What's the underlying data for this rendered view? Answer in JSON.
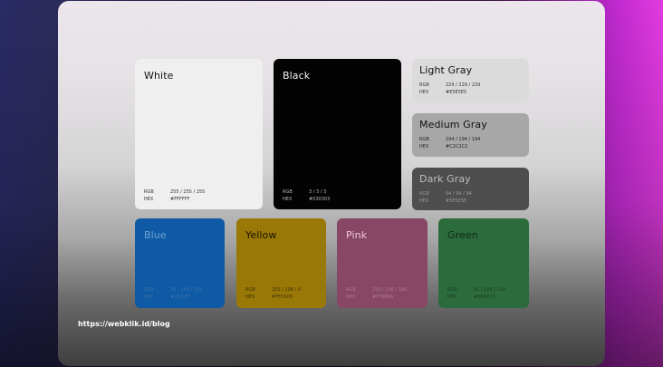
{
  "swatches": {
    "white": {
      "name": "White",
      "rgb_label": "RGB",
      "rgb": "255 / 255 / 255",
      "hex_label": "HEX",
      "hex": "#FFFFFF",
      "color": "#f0f0f0"
    },
    "black": {
      "name": "Black",
      "rgb_label": "RGB",
      "rgb": "3 / 3 / 3",
      "hex_label": "HEX",
      "hex": "#030303",
      "color": "#030303"
    },
    "light_gray": {
      "name": "Light Gray",
      "rgb_label": "RGB",
      "rgb": "229 / 229 / 229",
      "hex_label": "HEX",
      "hex": "#E5E5E5",
      "color": "#dcdcdc"
    },
    "medium_gray": {
      "name": "Medium Gray",
      "rgb_label": "RGB",
      "rgb": "194 / 194 / 194",
      "hex_label": "HEX",
      "hex": "#C2C2C2",
      "color": "#a9a9a9"
    },
    "dark_gray": {
      "name": "Dark Gray",
      "rgb_label": "RGB",
      "rgb": "94 / 94 / 94",
      "hex_label": "HEX",
      "hex": "#5E5E5E",
      "color": "#555555"
    },
    "blue": {
      "name": "Blue",
      "rgb_label": "RGB",
      "rgb": "30 / 144 / 255",
      "hex_label": "HEX",
      "hex": "#1E90FF",
      "color": "#0f5aa8"
    },
    "yellow": {
      "name": "Yellow",
      "rgb_label": "RGB",
      "rgb": "255 / 198 / 0",
      "hex_label": "HEX",
      "hex": "#FFC600",
      "color": "#9c7a05"
    },
    "pink": {
      "name": "Pink",
      "rgb_label": "RGB",
      "rgb": "255 / 136 / 186",
      "hex_label": "HEX",
      "hex": "#FF88BA",
      "color": "#8a4a68"
    },
    "green": {
      "name": "Green",
      "rgb_label": "RGB",
      "rgb": "91 / 198 / 114",
      "hex_label": "HEX",
      "hex": "#5BC672",
      "color": "#2d6e3e"
    }
  },
  "footer": {
    "url": "https://webklik.id/blog"
  }
}
